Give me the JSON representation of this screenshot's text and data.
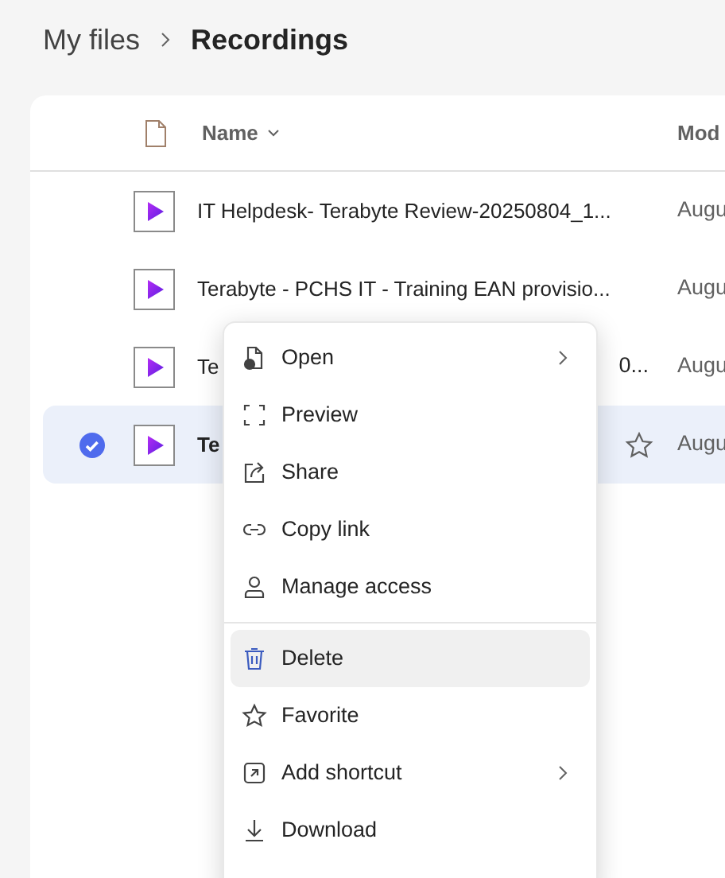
{
  "breadcrumb": [
    {
      "label": "My files",
      "current": false
    },
    {
      "label": "Recordings",
      "current": true
    }
  ],
  "table": {
    "columns": [
      "Name",
      "Mod"
    ],
    "rows": [
      {
        "name_start": "IT Helpdesk- Terabyte Review-20250804_1...",
        "name_end": "",
        "modified": "Augu",
        "selected": false,
        "favorite_shown": false
      },
      {
        "name_start": "Terabyte - PCHS IT - Training EAN provisio...",
        "name_end": "",
        "modified": "Augu",
        "selected": false,
        "favorite_shown": false
      },
      {
        "name_start": "Te",
        "name_end": "0...",
        "modified": "Augu",
        "selected": false,
        "favorite_shown": false
      },
      {
        "name_start": "Te",
        "name_end": "",
        "modified": "Augu",
        "selected": true,
        "favorite_shown": true
      }
    ]
  },
  "context_menu": {
    "items": [
      {
        "kind": "item",
        "label": "Open",
        "submenu": true,
        "hovered": false
      },
      {
        "kind": "item",
        "label": "Preview",
        "submenu": false,
        "hovered": false
      },
      {
        "kind": "item",
        "label": "Share",
        "submenu": false,
        "hovered": false
      },
      {
        "kind": "item",
        "label": "Copy link",
        "submenu": false,
        "hovered": false
      },
      {
        "kind": "item",
        "label": "Manage access",
        "submenu": false,
        "hovered": false
      },
      {
        "kind": "divider"
      },
      {
        "kind": "item",
        "label": "Delete",
        "submenu": false,
        "hovered": true
      },
      {
        "kind": "item",
        "label": "Favorite",
        "submenu": false,
        "hovered": false
      },
      {
        "kind": "item",
        "label": "Add shortcut",
        "submenu": true,
        "hovered": false
      },
      {
        "kind": "item",
        "label": "Download",
        "submenu": false,
        "hovered": false
      }
    ]
  }
}
